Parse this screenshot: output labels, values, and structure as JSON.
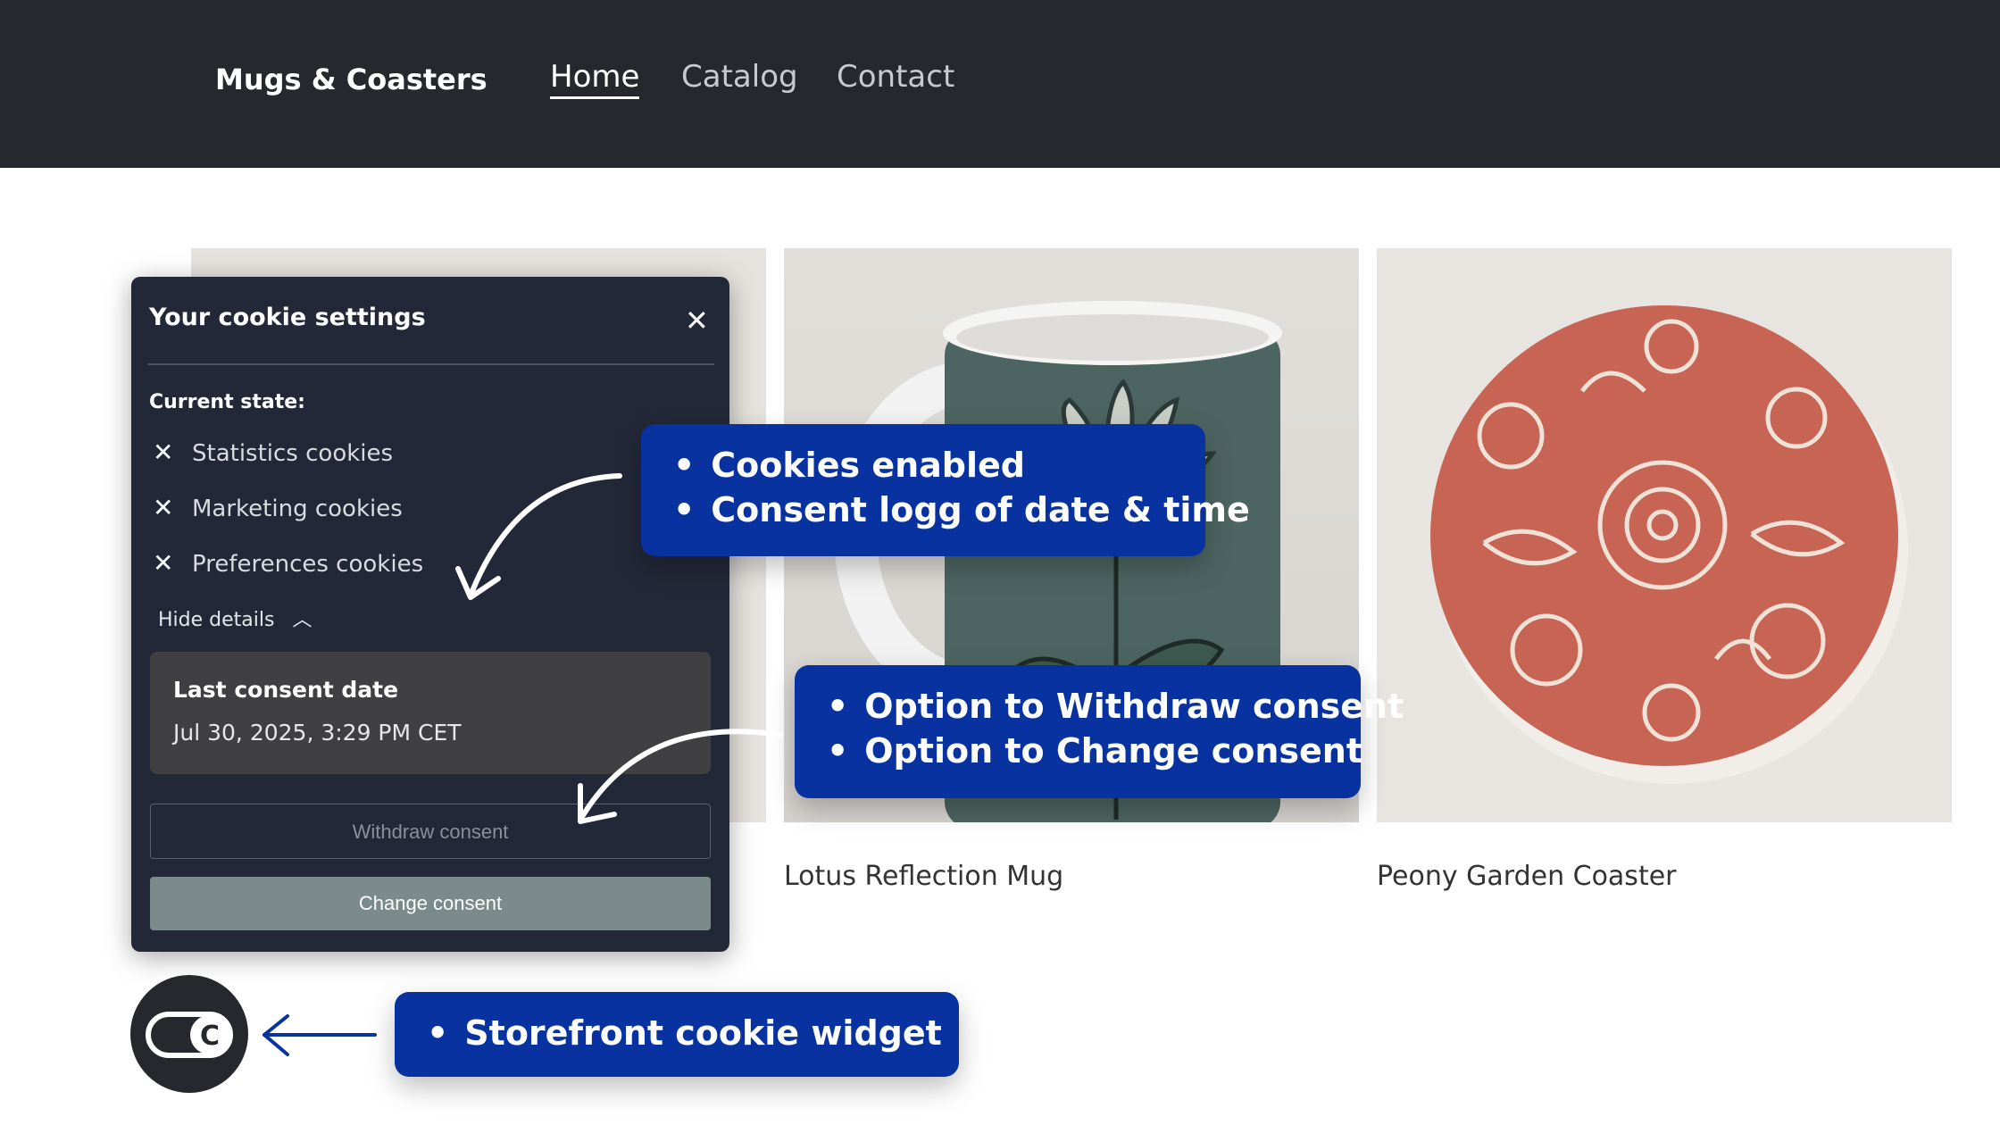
{
  "header": {
    "brand": "Mugs & Coasters",
    "nav": [
      "Home",
      "Catalog",
      "Contact"
    ],
    "active_nav": "Home"
  },
  "products": [
    {
      "title": ""
    },
    {
      "title": "Lotus Reflection Mug"
    },
    {
      "title": "Peony Garden Coaster"
    }
  ],
  "cookie_panel": {
    "title": "Your cookie settings",
    "close_icon": "close-icon",
    "current_state_label": "Current state:",
    "cookies": [
      "Statistics cookies",
      "Marketing cookies",
      "Preferences cookies"
    ],
    "hide_details": "Hide details",
    "last_consent_label": "Last consent date",
    "last_consent_value": "Jul 30, 2025, 3:29 PM CET",
    "withdraw_label": "Withdraw consent",
    "change_label": "Change consent"
  },
  "callouts": {
    "top": [
      "Cookies enabled",
      "Consent logg of date & time"
    ],
    "middle": [
      "Option to Withdraw consent",
      "Option to Change consent"
    ],
    "bottom": [
      "Storefront cookie widget"
    ]
  },
  "colors": {
    "header_bg": "#26282d",
    "panel_bg": "#232838",
    "callout_bg": "#0732a0",
    "coaster": "#c86454"
  }
}
